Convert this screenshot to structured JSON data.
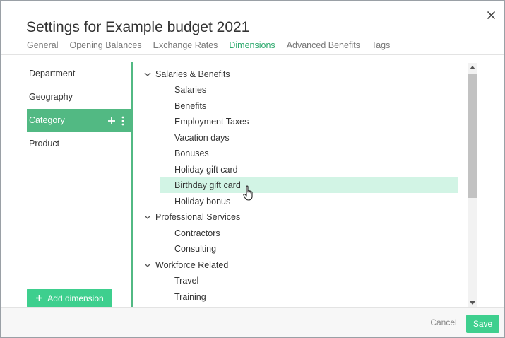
{
  "dialog": {
    "title": "Settings for Example budget 2021",
    "close_icon": "close-icon"
  },
  "tabs": [
    {
      "label": "General",
      "active": false
    },
    {
      "label": "Opening Balances",
      "active": false
    },
    {
      "label": "Exchange Rates",
      "active": false
    },
    {
      "label": "Dimensions",
      "active": true
    },
    {
      "label": "Advanced Benefits",
      "active": false
    },
    {
      "label": "Tags",
      "active": false
    }
  ],
  "sidebar": {
    "items": [
      {
        "label": "Department",
        "active": false
      },
      {
        "label": "Geography",
        "active": false
      },
      {
        "label": "Category",
        "active": true
      },
      {
        "label": "Product",
        "active": false
      }
    ],
    "add_icon": "plus-icon",
    "more_icon": "more-vertical-icon",
    "add_button_label": "Add dimension"
  },
  "tree": [
    {
      "type": "group",
      "label": "Salaries & Benefits",
      "expanded": true
    },
    {
      "type": "leaf",
      "label": "Salaries"
    },
    {
      "type": "leaf",
      "label": "Benefits"
    },
    {
      "type": "leaf",
      "label": "Employment Taxes"
    },
    {
      "type": "leaf",
      "label": "Vacation days"
    },
    {
      "type": "leaf",
      "label": "Bonuses"
    },
    {
      "type": "leaf",
      "label": "Holiday gift card"
    },
    {
      "type": "leaf",
      "label": "Birthday gift card",
      "selected": true
    },
    {
      "type": "leaf",
      "label": "Holiday bonus"
    },
    {
      "type": "group",
      "label": "Professional Services",
      "expanded": true
    },
    {
      "type": "leaf",
      "label": "Contractors"
    },
    {
      "type": "leaf",
      "label": "Consulting"
    },
    {
      "type": "group",
      "label": "Workforce Related",
      "expanded": true
    },
    {
      "type": "leaf",
      "label": "Travel"
    },
    {
      "type": "leaf",
      "label": "Training"
    }
  ],
  "footer": {
    "cancel_label": "Cancel",
    "save_label": "Save"
  },
  "colors": {
    "accent": "#3ecf8e",
    "sidebar_active": "#52b983",
    "tab_active": "#2eaa6e",
    "selected_row": "#d2f4e5"
  }
}
